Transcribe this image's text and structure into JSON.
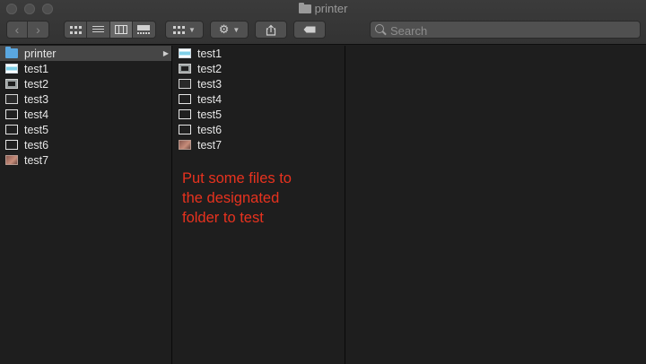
{
  "window": {
    "title": "printer"
  },
  "toolbar": {
    "search_placeholder": "Search"
  },
  "column1": {
    "items": [
      {
        "label": "printer",
        "icon": "folder-icon",
        "selected": true,
        "has_children": true
      },
      {
        "label": "test1",
        "icon": "image-file-icon"
      },
      {
        "label": "test2",
        "icon": "screenshot-file-icon"
      },
      {
        "label": "test3",
        "icon": "dark-file-icon"
      },
      {
        "label": "test4",
        "icon": "file-icon"
      },
      {
        "label": "test5",
        "icon": "file-icon"
      },
      {
        "label": "test6",
        "icon": "file-icon"
      },
      {
        "label": "test7",
        "icon": "photo-file-icon"
      }
    ]
  },
  "column2": {
    "items": [
      {
        "label": "test1",
        "icon": "image-file-icon"
      },
      {
        "label": "test2",
        "icon": "screenshot-file-icon"
      },
      {
        "label": "test3",
        "icon": "dark-file-icon"
      },
      {
        "label": "test4",
        "icon": "file-icon"
      },
      {
        "label": "test5",
        "icon": "file-icon"
      },
      {
        "label": "test6",
        "icon": "file-icon"
      },
      {
        "label": "test7",
        "icon": "photo-file-icon"
      }
    ]
  },
  "note": {
    "line1": "Put some files to",
    "line2": "the designated",
    "line3": "folder to test",
    "color": "#e8321e"
  },
  "colors": {
    "background": "#1e1e1e",
    "toolbar": "#363636",
    "selection": "#464646",
    "folder": "#5aa7e0"
  }
}
